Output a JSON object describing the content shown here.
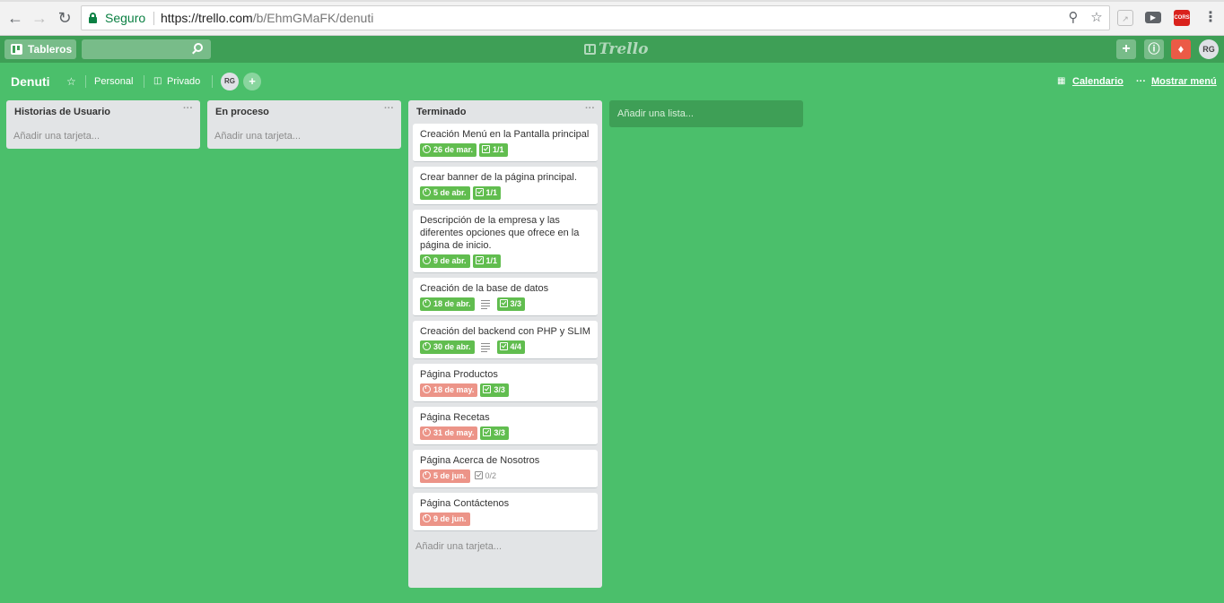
{
  "browser": {
    "secure_label": "Seguro",
    "url_host": "https://trello.com",
    "url_path": "/b/EhmGMaFK/denuti",
    "ext_cors": "CORS"
  },
  "header": {
    "boards_label": "Tableros",
    "search_placeholder": "",
    "logo_text": "Trello",
    "avatar": "RG"
  },
  "board": {
    "name": "Denuti",
    "team": "Personal",
    "visibility": "Privado",
    "member": "RG",
    "calendar_label": "Calendario",
    "menu_label": "Mostrar menú"
  },
  "lists": [
    {
      "title": "Historias de Usuario",
      "add_card": "Añadir una tarjeta..."
    },
    {
      "title": "En proceso",
      "add_card": "Añadir una tarjeta..."
    },
    {
      "title": "Terminado",
      "add_card": "Añadir una tarjeta...",
      "cards": [
        {
          "title": "Creación Menú en la Pantalla principal",
          "due": "26 de mar.",
          "due_status": "complete",
          "checklist": "1/1",
          "checklist_status": "complete"
        },
        {
          "title": "Crear banner de la página principal.",
          "due": "5 de abr.",
          "due_status": "complete",
          "checklist": "1/1",
          "checklist_status": "complete"
        },
        {
          "title": "Descripción de la empresa y las diferentes opciones que ofrece en la página de inicio.",
          "due": "9 de abr.",
          "due_status": "complete",
          "checklist": "1/1",
          "checklist_status": "complete"
        },
        {
          "title": "Creación de la base de datos",
          "due": "18 de abr.",
          "due_status": "complete",
          "has_description": true,
          "checklist": "3/3",
          "checklist_status": "complete"
        },
        {
          "title": "Creación del backend con PHP y SLIM",
          "due": "30 de abr.",
          "due_status": "complete",
          "has_description": true,
          "checklist": "4/4",
          "checklist_status": "complete"
        },
        {
          "title": "Página Productos",
          "due": "18 de may.",
          "due_status": "overdue",
          "checklist": "3/3",
          "checklist_status": "complete"
        },
        {
          "title": "Página Recetas",
          "due": "31 de may.",
          "due_status": "overdue",
          "checklist": "3/3",
          "checklist_status": "complete"
        },
        {
          "title": "Página Acerca de Nosotros",
          "due": "5 de jun.",
          "due_status": "overdue",
          "checklist": "0/2",
          "checklist_status": "incomplete"
        },
        {
          "title": "Página Contáctenos",
          "due": "9 de jun.",
          "due_status": "overdue"
        }
      ]
    }
  ],
  "add_list_label": "Añadir una lista...",
  "colors": {
    "board_bg": "#4bbf6b",
    "header_bg": "#3e9f56",
    "due_complete": "#61bd4f",
    "due_overdue": "#ec9488",
    "notification": "#eb5a46"
  }
}
